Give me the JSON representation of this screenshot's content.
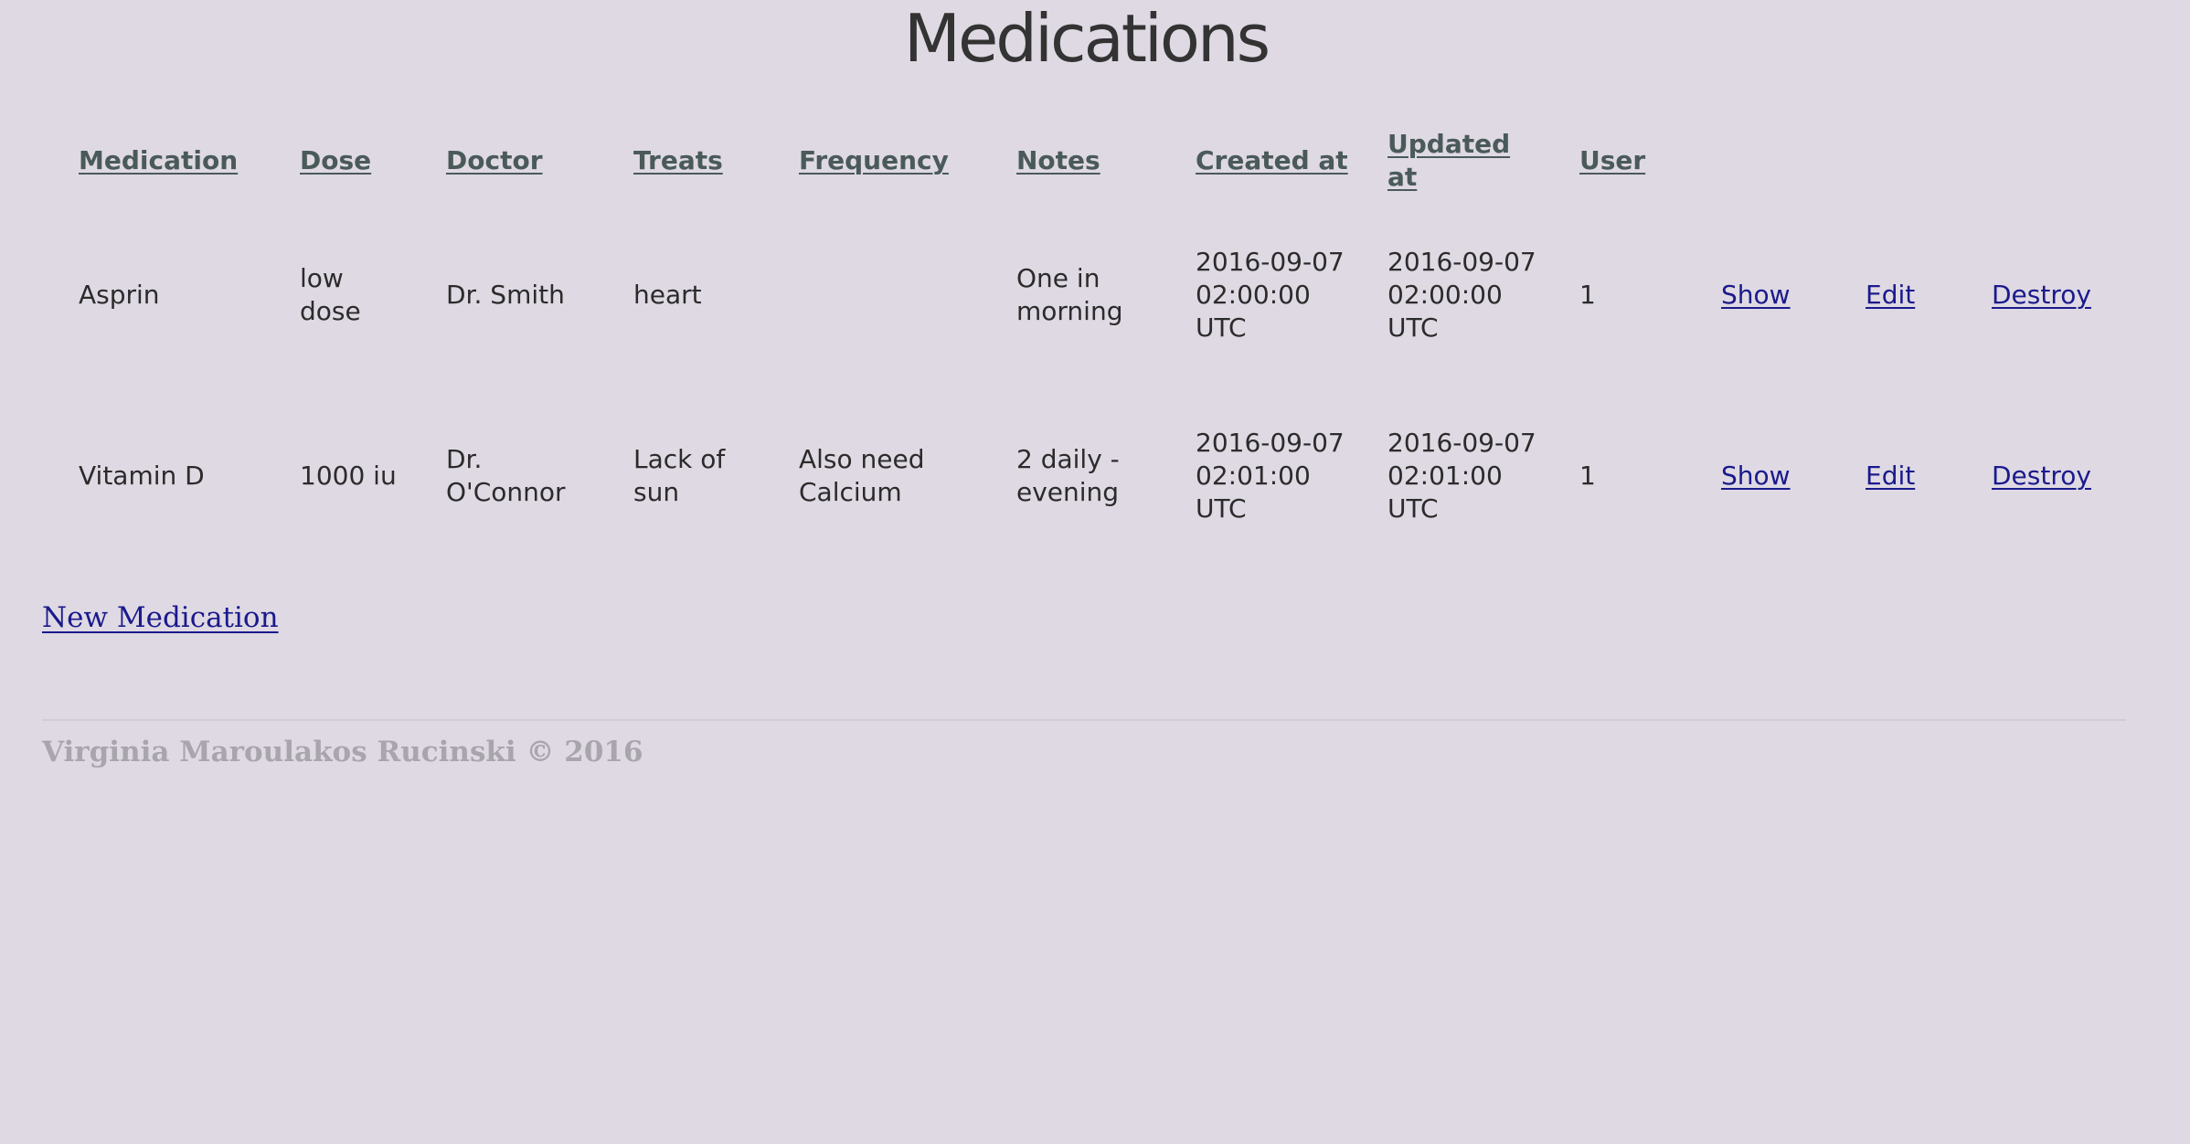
{
  "page": {
    "title": "Medications"
  },
  "table": {
    "columns": [
      "Medication",
      "Dose",
      "Doctor",
      "Treats",
      "Frequency",
      "Notes",
      "Created at",
      "Updated at",
      "User"
    ],
    "rows": [
      {
        "medication": "Asprin",
        "dose": "low dose",
        "doctor": "Dr. Smith",
        "treats": "heart",
        "frequency": "",
        "notes": "One in morning",
        "created_at": "2016-09-07 02:00:00 UTC",
        "updated_at": "2016-09-07 02:00:00 UTC",
        "user": "1",
        "show_label": "Show",
        "edit_label": "Edit",
        "destroy_label": "Destroy"
      },
      {
        "medication": "Vitamin D",
        "dose": "1000 iu",
        "doctor": "Dr. O'Connor",
        "treats": "Lack of sun",
        "frequency": "Also need Calcium",
        "notes": "2 daily - evening",
        "created_at": "2016-09-07 02:01:00 UTC",
        "updated_at": "2016-09-07 02:01:00 UTC",
        "user": "1",
        "show_label": "Show",
        "edit_label": "Edit",
        "destroy_label": "Destroy"
      }
    ]
  },
  "actions": {
    "new_label": "New Medication"
  },
  "footer": {
    "text": "Virginia Maroulakos Rucinski © 2016"
  },
  "colors": {
    "background": "#dfd9e3",
    "link": "#1a1a8c",
    "header_text": "#4a5a5a",
    "footer_text": "#a9a5ad"
  }
}
